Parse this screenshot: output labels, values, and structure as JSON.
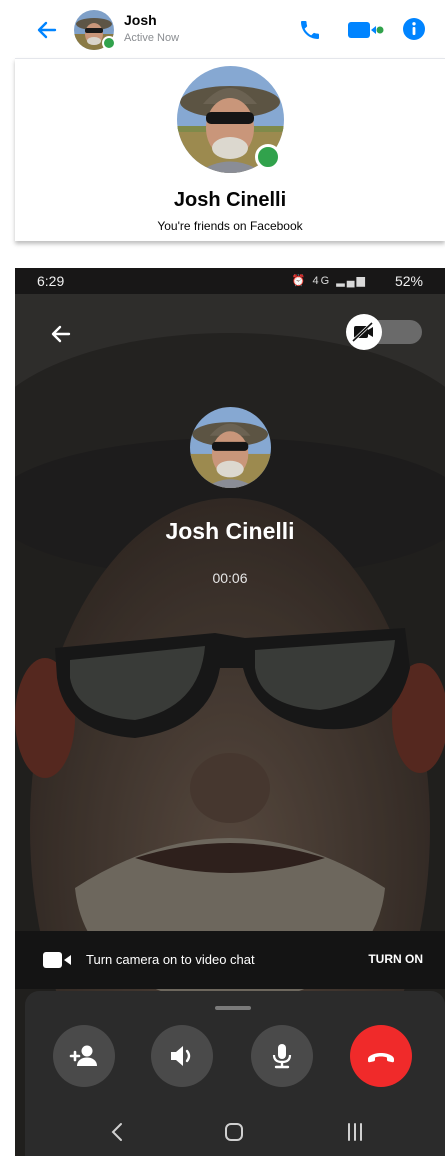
{
  "chat_header": {
    "name": "Josh",
    "status": "Active Now"
  },
  "profile_card": {
    "name": "Josh Cinelli",
    "subtitle": "You're friends on Facebook"
  },
  "status_bar": {
    "time": "6:29",
    "signal_text": "4G",
    "battery": "52%"
  },
  "call": {
    "name": "Josh Cinelli",
    "timer": "00:06"
  },
  "camera_banner": {
    "text": "Turn camera on to video chat",
    "button": "TURN ON"
  },
  "colors": {
    "messenger_blue": "#0084ff",
    "online_green": "#31a24c",
    "end_call_red": "#f02a2a"
  },
  "icons": [
    "back-arrow-icon",
    "phone-icon",
    "video-camera-icon",
    "info-icon",
    "camera-off-icon",
    "add-person-icon",
    "speaker-icon",
    "microphone-icon",
    "hang-up-icon",
    "nav-back-icon",
    "nav-home-icon",
    "nav-recents-icon"
  ]
}
